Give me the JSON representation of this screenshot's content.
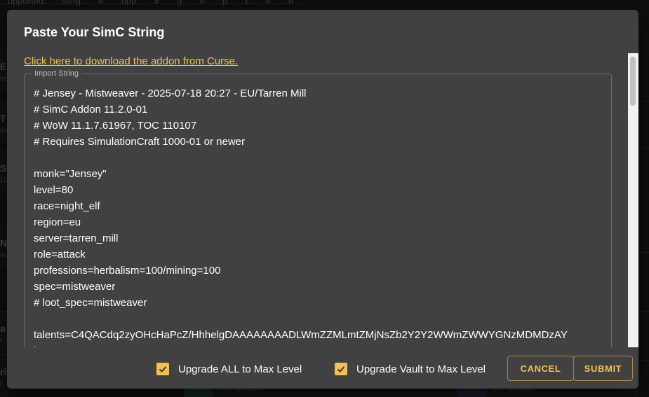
{
  "background": {
    "top_line": "...upported... ...sting... ...e... ...upp... ...tr... ...g... ...e... ...p... ...t... ...e... ...e...",
    "left_fragments": [
      {
        "big": "EA",
        "small": "be"
      },
      {
        "big": "T",
        "small": "ho"
      },
      {
        "big": "S",
        "small": "11"
      },
      {
        "big": "N",
        "small": "mi"
      },
      {
        "big": "a",
        "small": "t"
      },
      {
        "big": "ri",
        "small": "t"
      }
    ],
    "bottom_sub_left": "US - Default",
    "bottom_sub_right": "US - Default"
  },
  "dialog": {
    "title": "Paste Your SimC String",
    "download_link": "Click here to download the addon from Curse.",
    "import_label": "Import String",
    "import_lines": [
      "# Jensey - Mistweaver - 2025-07-18 20:27 - EU/Tarren Mill",
      "# SimC Addon 11.2.0-01",
      "# WoW 11.1.7.61967, TOC 110107",
      "# Requires SimulationCraft 1000-01 or newer",
      "",
      "monk=\"Jensey\"",
      "level=80",
      "race=night_elf",
      "region=eu",
      "server=tarren_mill",
      "role=attack",
      "professions=herbalism=100/mining=100",
      "spec=mistweaver",
      "# loot_spec=mistweaver",
      "",
      "talents=C4QACdq2zyOHcHaPcZ/HhhelgDAAAAAAAADLWmZZMLmtZMjNsZb2Y2Y2WWmZWWYGNzMDMDzAY",
      "bmZGmNGDzwDMBAAAAYGmGmtZWmNLzGwsNzMBBAGA"
    ]
  },
  "footer": {
    "upgrade_all_label": "Upgrade ALL to Max Level",
    "upgrade_all_checked": true,
    "upgrade_vault_label": "Upgrade Vault to Max Level",
    "upgrade_vault_checked": true,
    "cancel_label": "CANCEL",
    "submit_label": "SUBMIT"
  },
  "colors": {
    "accent": "#f2c14e",
    "dialog_bg": "#414141",
    "button_border": "#a88a48"
  },
  "icons": {
    "checkbox": "check-icon"
  }
}
